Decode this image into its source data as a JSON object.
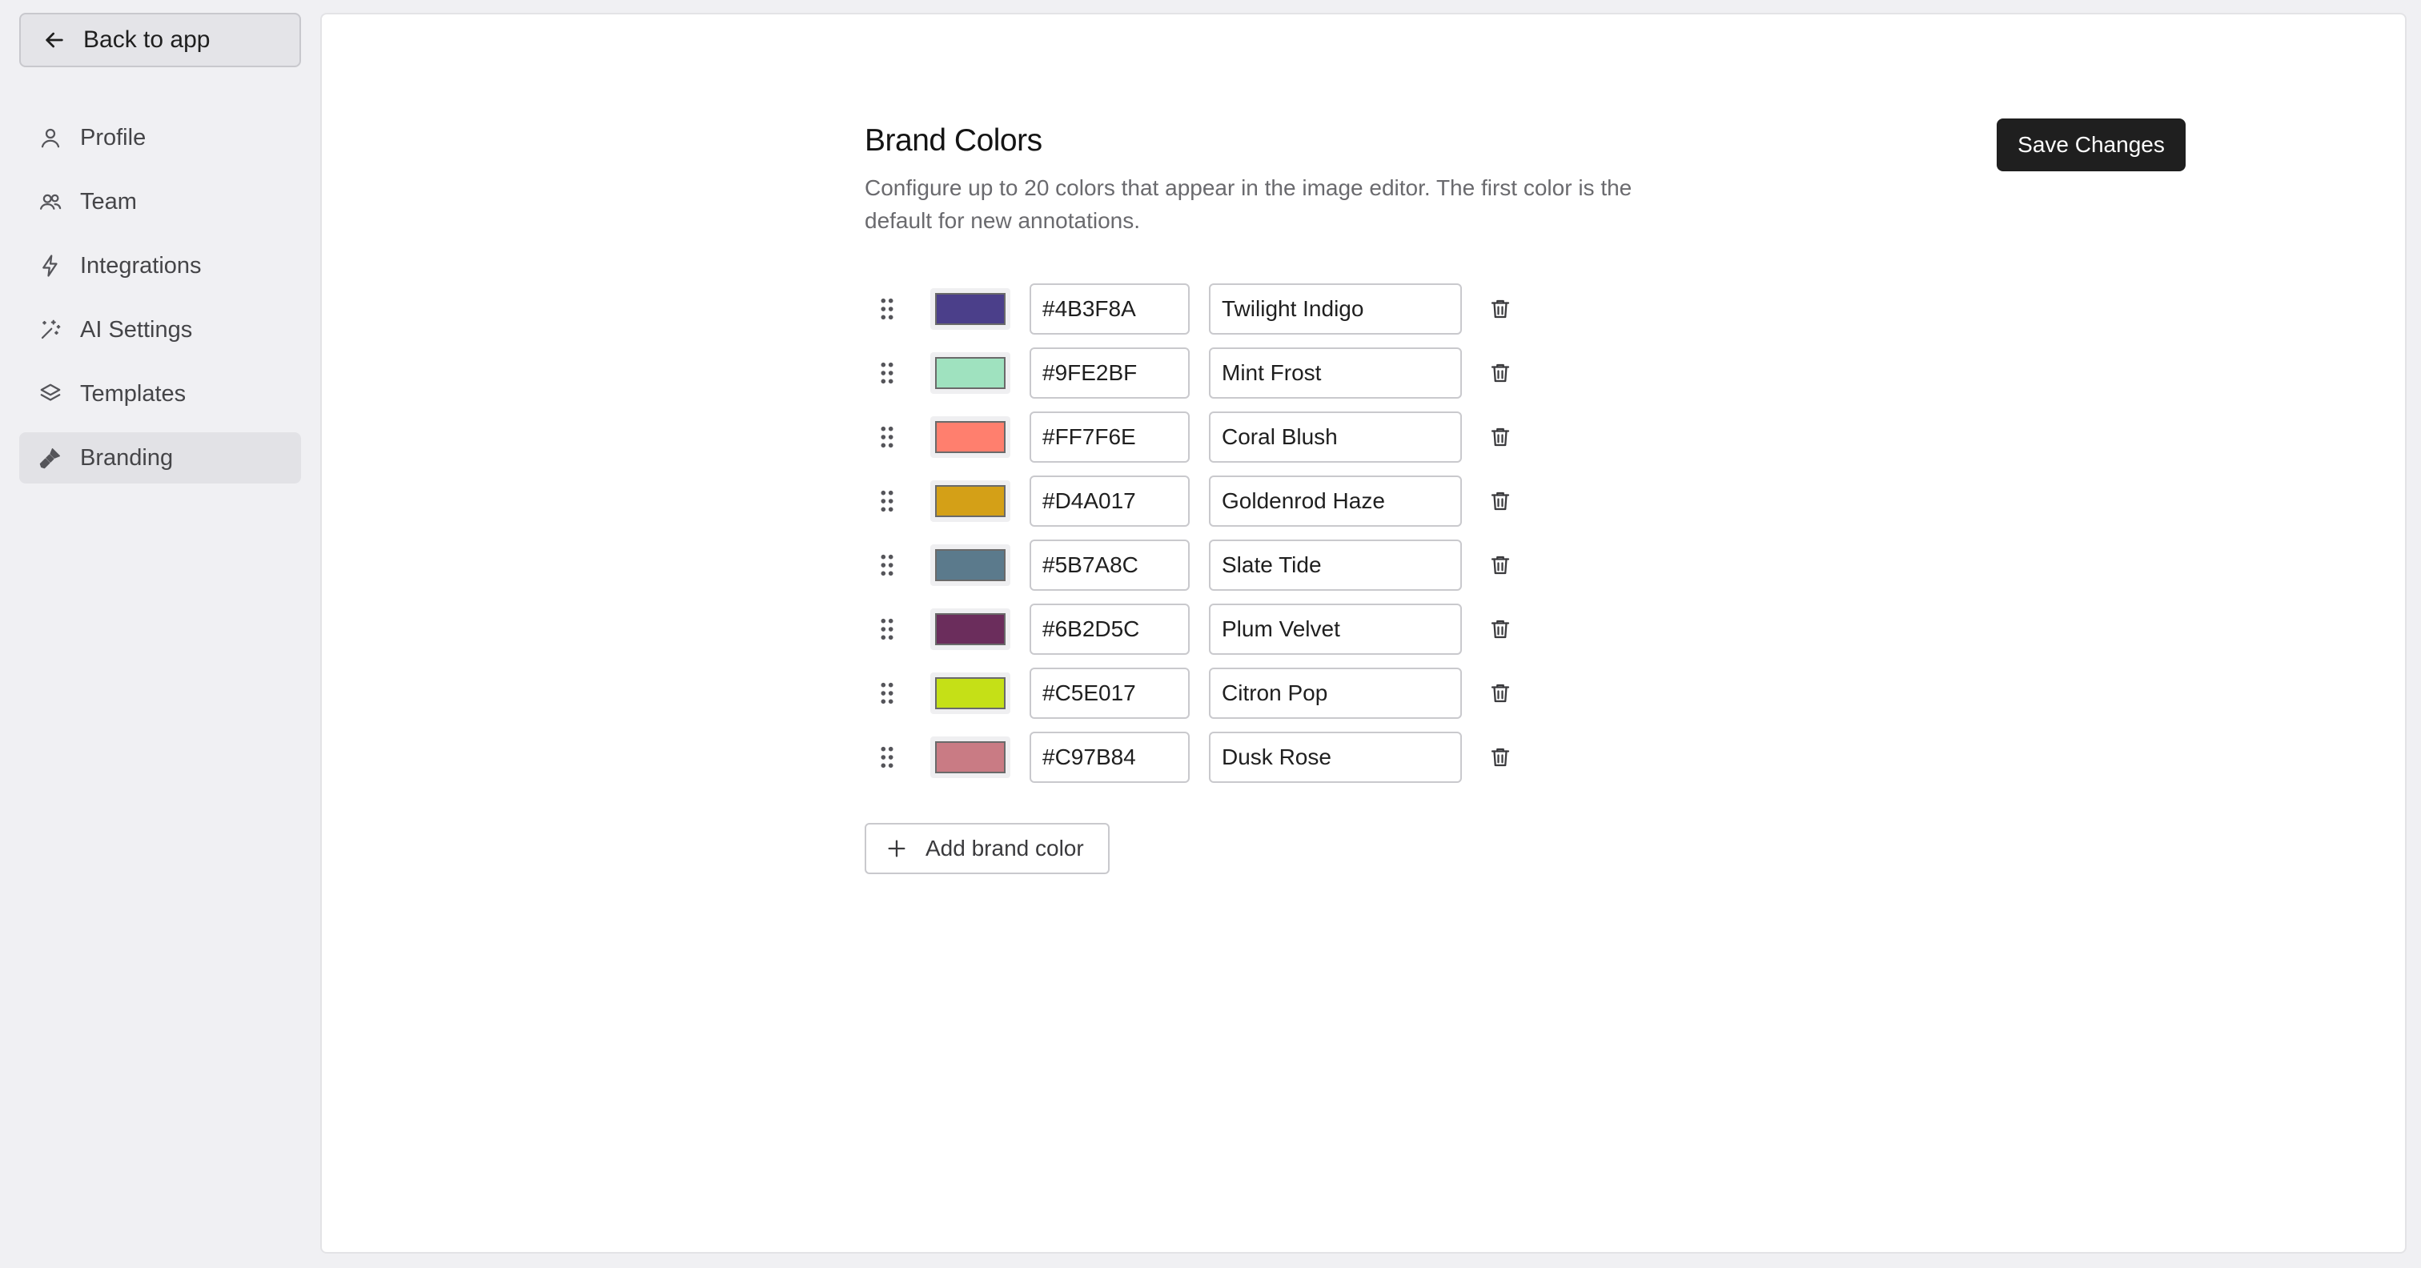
{
  "sidebar": {
    "back_label": "Back to app",
    "back_icon": "arrow-left-icon",
    "items": [
      {
        "label": "Profile",
        "icon": "user-icon",
        "active": false
      },
      {
        "label": "Team",
        "icon": "users-icon",
        "active": false
      },
      {
        "label": "Integrations",
        "icon": "lightning-icon",
        "active": false
      },
      {
        "label": "AI Settings",
        "icon": "sparkle-wand-icon",
        "active": false
      },
      {
        "label": "Templates",
        "icon": "layers-icon",
        "active": false
      },
      {
        "label": "Branding",
        "icon": "paint-brush-icon",
        "active": true
      }
    ]
  },
  "main": {
    "title": "Brand Colors",
    "description": "Configure up to 20 colors that appear in the image editor. The first color is the default for new annotations.",
    "save_label": "Save Changes",
    "add_label": "Add brand color",
    "colors": [
      {
        "hex": "#4B3F8A",
        "name": "Twilight Indigo"
      },
      {
        "hex": "#9FE2BF",
        "name": "Mint Frost"
      },
      {
        "hex": "#FF7F6E",
        "name": "Coral Blush"
      },
      {
        "hex": "#D4A017",
        "name": "Goldenrod Haze"
      },
      {
        "hex": "#5B7A8C",
        "name": "Slate Tide"
      },
      {
        "hex": "#6B2D5C",
        "name": "Plum Velvet"
      },
      {
        "hex": "#C5E017",
        "name": "Citron Pop"
      },
      {
        "hex": "#C97B84",
        "name": "Dusk Rose"
      }
    ]
  }
}
